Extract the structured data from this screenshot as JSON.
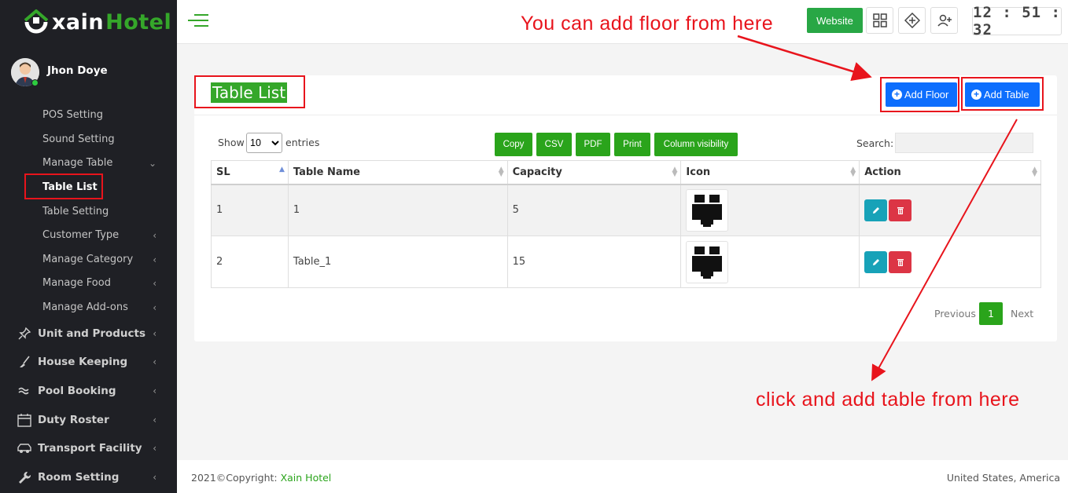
{
  "brand": {
    "word1": "xain",
    "word2": "Hotel"
  },
  "user": {
    "name": "Jhon Doye"
  },
  "sidebar": {
    "sub_items": [
      {
        "label": "POS Setting"
      },
      {
        "label": "Sound Setting"
      },
      {
        "label": "Manage Table"
      },
      {
        "label": "Table List"
      },
      {
        "label": "Table Setting"
      },
      {
        "label": "Customer Type"
      },
      {
        "label": "Manage Category"
      },
      {
        "label": "Manage Food"
      },
      {
        "label": "Manage Add-ons"
      }
    ],
    "main_items": [
      {
        "label": "Unit and Products",
        "icon": "pin-icon"
      },
      {
        "label": "House Keeping",
        "icon": "broom-icon"
      },
      {
        "label": "Pool Booking",
        "icon": "waves-icon"
      },
      {
        "label": "Duty Roster",
        "icon": "calendar-icon"
      },
      {
        "label": "Transport Facility",
        "icon": "car-icon"
      },
      {
        "label": "Room Setting",
        "icon": "wrench-icon"
      }
    ]
  },
  "topbar": {
    "website_label": "Website",
    "clock": "12 : 51 : 32",
    "icons": [
      "grid-icon",
      "diamond-arrows-icon",
      "add-user-icon"
    ]
  },
  "annotations": {
    "floor_note": "You can add floor from here",
    "table_note": "click and add table from here"
  },
  "card": {
    "title": "Table List",
    "add_floor_label": "Add Floor",
    "add_table_label": "Add Table"
  },
  "controls": {
    "show_label": "Show",
    "entries_value": "10",
    "entries_label": "entries",
    "buttons": [
      "Copy",
      "CSV",
      "PDF",
      "Print",
      "Column visibility"
    ],
    "search_label": "Search:",
    "search_value": ""
  },
  "table": {
    "headers": [
      "SL",
      "Table Name",
      "Capacity",
      "Icon",
      "Action"
    ],
    "rows": [
      {
        "sl": "1",
        "name": "1",
        "capacity": "5",
        "icon": "dining-table-icon"
      },
      {
        "sl": "2",
        "name": "Table_1",
        "capacity": "15",
        "icon": "dining-table-icon"
      }
    ]
  },
  "pagination": {
    "previous": "Previous",
    "current": "1",
    "next": "Next"
  },
  "footer": {
    "copyright_prefix": "2021©Copyright: ",
    "brand": "Xain Hotel",
    "location": "United States, America"
  },
  "colors": {
    "accent": "#35a72a",
    "primary": "#0d6efd",
    "annotation": "#e8141c",
    "sidebar_bg": "#1f2025"
  }
}
